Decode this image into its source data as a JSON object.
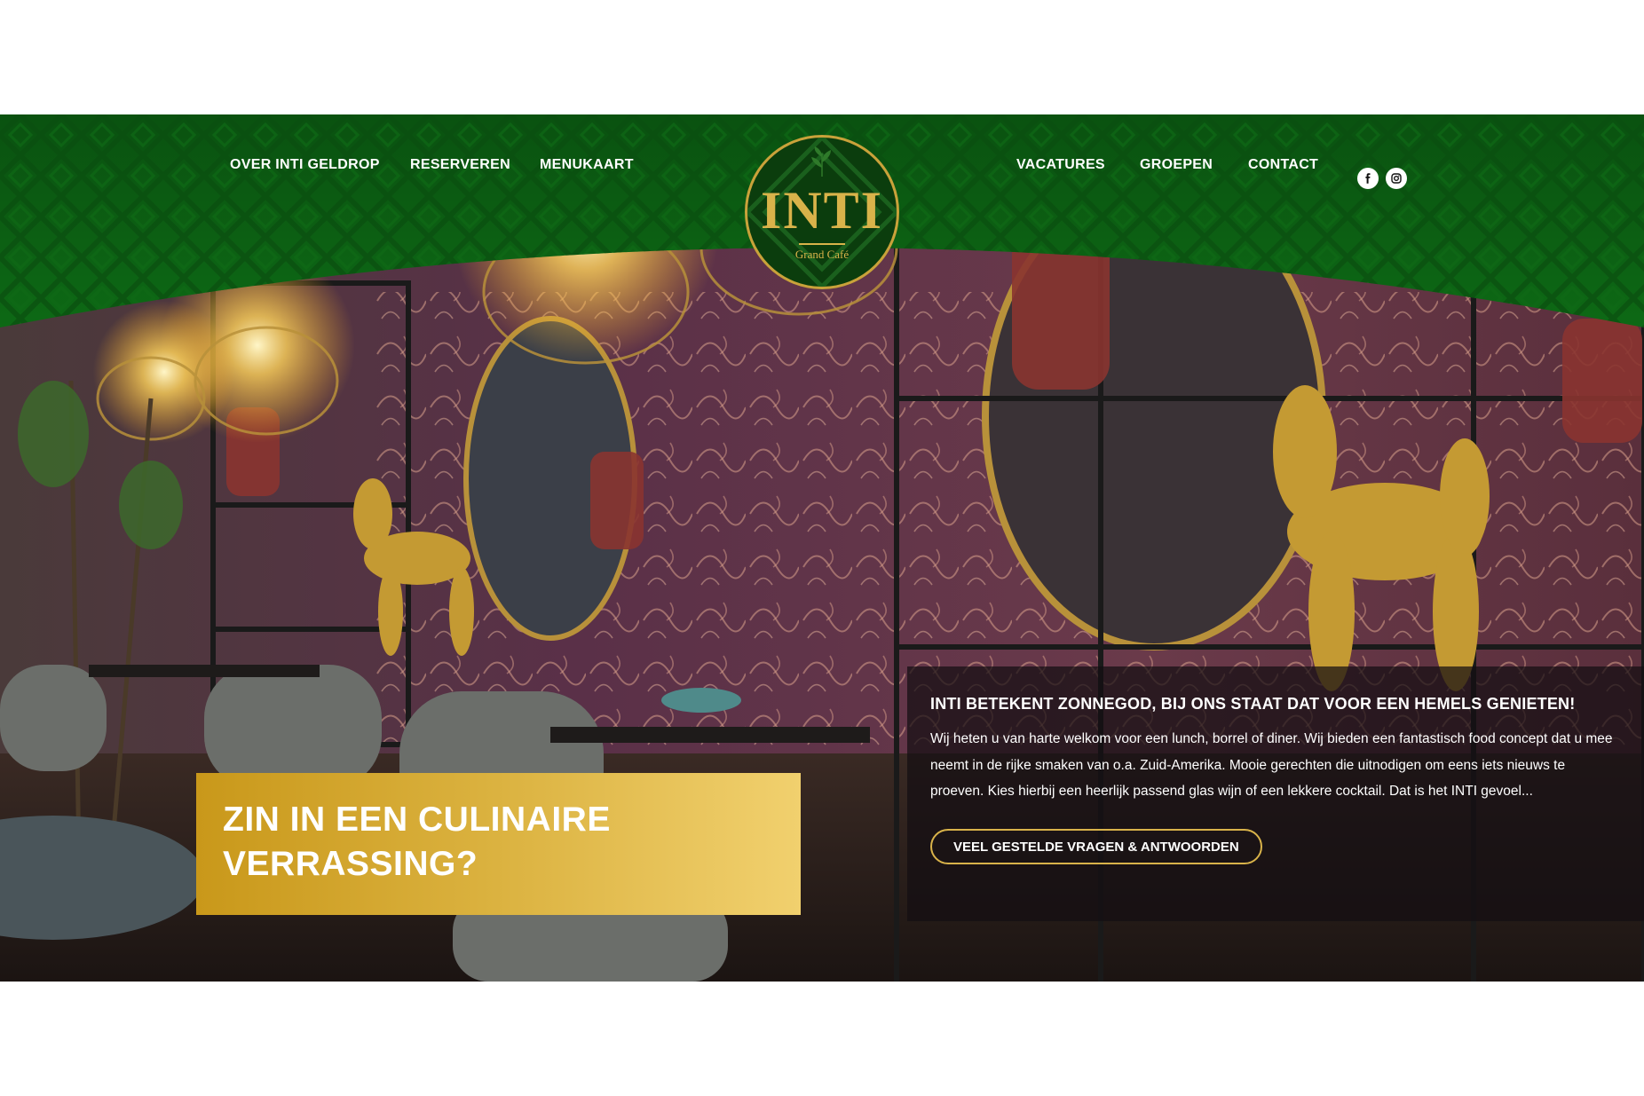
{
  "nav": {
    "left": [
      "OVER INTI GELDROP",
      "RESERVEREN",
      "MENUKAART"
    ],
    "right": [
      "VACATURES",
      "GROEPEN",
      "CONTACT"
    ]
  },
  "social": {
    "facebook_icon": "facebook-icon",
    "instagram_icon": "instagram-icon"
  },
  "logo": {
    "name": "INTI",
    "subtitle": "Grand Café"
  },
  "cta": {
    "title": "ZIN IN EEN CULINAIRE VERRASSING?"
  },
  "info": {
    "heading": "INTI BETEKENT ZONNEGOD, BIJ ONS STAAT DAT VOOR EEN HEMELS GENIETEN!",
    "text": "Wij heten u van harte welkom voor een lunch, borrel of diner. Wij bieden een fantastisch food concept dat u mee neemt in de rijke smaken van o.a. Zuid-Amerika. Mooie gerechten die uitnodigen om eens iets nieuws te proeven. Kies hierbij een heerlijk passend glas wijn of een lekkere cocktail. Dat is het INTI gevoel...",
    "button": "VEEL GESTELDE VRAGEN & ANTWOORDEN"
  },
  "colors": {
    "green": "#0b5a12",
    "gold": "#d9b34a",
    "white": "#ffffff"
  }
}
